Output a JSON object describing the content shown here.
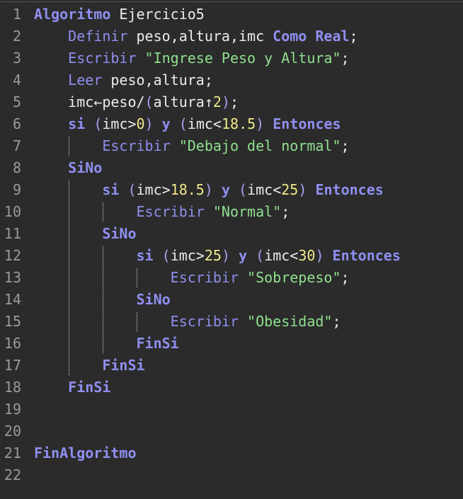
{
  "editor": {
    "lines": [
      [
        [
          "kw",
          "Algoritmo"
        ],
        [
          "id",
          " Ejercicio5"
        ]
      ],
      [
        [
          "id",
          "    "
        ],
        [
          "kwn",
          "Definir"
        ],
        [
          "id",
          " peso,altura,imc "
        ],
        [
          "kw",
          "Como Real"
        ],
        [
          "id",
          ";"
        ]
      ],
      [
        [
          "id",
          "    "
        ],
        [
          "kwn",
          "Escribir"
        ],
        [
          "id",
          " "
        ],
        [
          "str",
          "\"Ingrese Peso y Altura\""
        ],
        [
          "id",
          ";"
        ]
      ],
      [
        [
          "id",
          "    "
        ],
        [
          "kwn",
          "Leer"
        ],
        [
          "id",
          " peso,altura;"
        ]
      ],
      [
        [
          "id",
          "    imc←peso/"
        ],
        [
          "op",
          "("
        ],
        [
          "id",
          "altura↑"
        ],
        [
          "num",
          "2"
        ],
        [
          "op",
          ")"
        ],
        [
          "id",
          ";"
        ]
      ],
      [
        [
          "id",
          "    "
        ],
        [
          "kw",
          "si"
        ],
        [
          "id",
          " "
        ],
        [
          "op",
          "("
        ],
        [
          "id",
          "imc>"
        ],
        [
          "num",
          "0"
        ],
        [
          "op",
          ")"
        ],
        [
          "id",
          " "
        ],
        [
          "kw",
          "y"
        ],
        [
          "id",
          " "
        ],
        [
          "op",
          "("
        ],
        [
          "id",
          "imc<"
        ],
        [
          "num",
          "18.5"
        ],
        [
          "op",
          ")"
        ],
        [
          "id",
          " "
        ],
        [
          "kw",
          "Entonces"
        ]
      ],
      [
        [
          "id",
          "        "
        ],
        [
          "kwn",
          "Escribir"
        ],
        [
          "id",
          " "
        ],
        [
          "str",
          "\"Debajo del normal\""
        ],
        [
          "id",
          ";"
        ]
      ],
      [
        [
          "id",
          "    "
        ],
        [
          "kw",
          "SiNo"
        ]
      ],
      [
        [
          "id",
          "        "
        ],
        [
          "kw",
          "si"
        ],
        [
          "id",
          " "
        ],
        [
          "op",
          "("
        ],
        [
          "id",
          "imc>"
        ],
        [
          "num",
          "18.5"
        ],
        [
          "op",
          ")"
        ],
        [
          "id",
          " "
        ],
        [
          "kw",
          "y"
        ],
        [
          "id",
          " "
        ],
        [
          "op",
          "("
        ],
        [
          "id",
          "imc<"
        ],
        [
          "num",
          "25"
        ],
        [
          "op",
          ")"
        ],
        [
          "id",
          " "
        ],
        [
          "kw",
          "Entonces"
        ]
      ],
      [
        [
          "id",
          "            "
        ],
        [
          "kwn",
          "Escribir"
        ],
        [
          "id",
          " "
        ],
        [
          "str",
          "\"Normal\""
        ],
        [
          "id",
          ";"
        ]
      ],
      [
        [
          "id",
          "        "
        ],
        [
          "kw",
          "SiNo"
        ]
      ],
      [
        [
          "id",
          "            "
        ],
        [
          "kw",
          "si"
        ],
        [
          "id",
          " "
        ],
        [
          "op",
          "("
        ],
        [
          "id",
          "imc>"
        ],
        [
          "num",
          "25"
        ],
        [
          "op",
          ")"
        ],
        [
          "id",
          " "
        ],
        [
          "kw",
          "y"
        ],
        [
          "id",
          " "
        ],
        [
          "op",
          "("
        ],
        [
          "id",
          "imc<"
        ],
        [
          "num",
          "30"
        ],
        [
          "op",
          ")"
        ],
        [
          "id",
          " "
        ],
        [
          "kw",
          "Entonces"
        ]
      ],
      [
        [
          "id",
          "                "
        ],
        [
          "kwn",
          "Escribir"
        ],
        [
          "id",
          " "
        ],
        [
          "str",
          "\"Sobrepeso\""
        ],
        [
          "id",
          ";"
        ]
      ],
      [
        [
          "id",
          "            "
        ],
        [
          "kw",
          "SiNo"
        ]
      ],
      [
        [
          "id",
          "                "
        ],
        [
          "kwn",
          "Escribir"
        ],
        [
          "id",
          " "
        ],
        [
          "str",
          "\"Obesidad\""
        ],
        [
          "id",
          ";"
        ]
      ],
      [
        [
          "id",
          "            "
        ],
        [
          "kw",
          "FinSi"
        ]
      ],
      [
        [
          "id",
          "        "
        ],
        [
          "kw",
          "FinSi"
        ]
      ],
      [
        [
          "id",
          "    "
        ],
        [
          "kw",
          "FinSi"
        ]
      ],
      [],
      [],
      [
        [
          "kw",
          "FinAlgoritmo"
        ]
      ],
      []
    ],
    "colors": {
      "background": "#2b2b2b",
      "keyword": "#8f8ff0",
      "string": "#8fe08f",
      "number": "#f0e88a",
      "text": "#ececec",
      "line_number": "#9a9a9a"
    }
  }
}
